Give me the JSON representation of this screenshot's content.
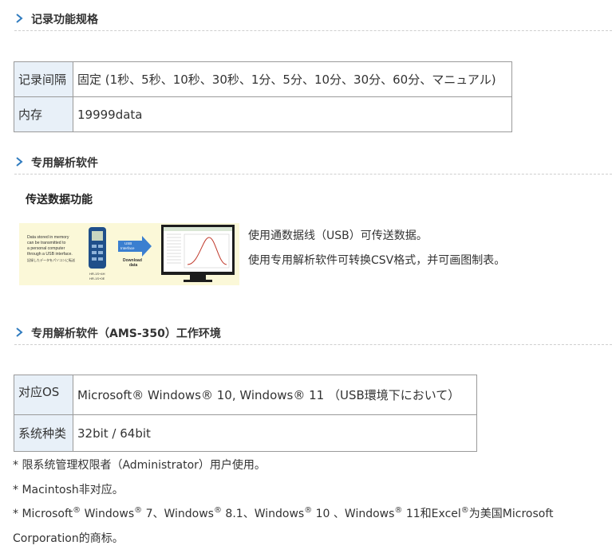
{
  "section1": {
    "title": "记录功能规格"
  },
  "record_table": {
    "rows": [
      {
        "label": "记录间隔",
        "value": "固定 (1秒、5秒、10秒、30秒、1分、5分、10分、30分、60分、マニュアル)"
      },
      {
        "label": "内存",
        "value": "19999data"
      }
    ]
  },
  "section2": {
    "title": "专用解析软件"
  },
  "transfer": {
    "subtitle": "传送数据功能",
    "illustration": {
      "memory_text": [
        "Data stored in memory",
        "can be transmitted to",
        "a personal computer",
        "through a USB interface."
      ],
      "small_jp": "記録したデータをパソコンに転送",
      "usb_label": [
        "USB",
        "Interface"
      ],
      "download_label": [
        "Download",
        "data"
      ],
      "model_labels": [
        "HR-1S+4H",
        "HR-1S+0E"
      ]
    },
    "desc_lines": [
      "使用通数据线（USB）可传送数据。",
      "使用专用解析软件可转换CSV格式，并可画图制表。"
    ]
  },
  "section3": {
    "title": "专用解析软件（AMS-350）工作环境"
  },
  "env_table": {
    "rows": [
      {
        "label": "对应OS",
        "value": "Microsoft® Windows® 10, Windows® 11 （USB環境下において）"
      },
      {
        "label": "系统种类",
        "value": "32bit / 64bit"
      }
    ]
  },
  "notes": {
    "n1": "* 限系统管理权限者（Administrator）用户使用。",
    "n2": "* Macintosh非对应。",
    "n3": {
      "p1": "* Microsoft",
      "r1": "®",
      "p2": " Windows",
      "r2": "®",
      "p3": " 7、Windows",
      "r3": "®",
      "p4": " 8.1、Windows",
      "r4": "®",
      "p5": " 10 、Windows",
      "r5": "®",
      "p6": " 11和Excel",
      "r6": "®",
      "p7": "为美国Microsoft",
      "line2": "Corporation的商标。"
    }
  },
  "colors": {
    "accent": "#2f7bbf",
    "label_bg": "#e8f0f8",
    "illus_bg": "#fbf8d8"
  }
}
